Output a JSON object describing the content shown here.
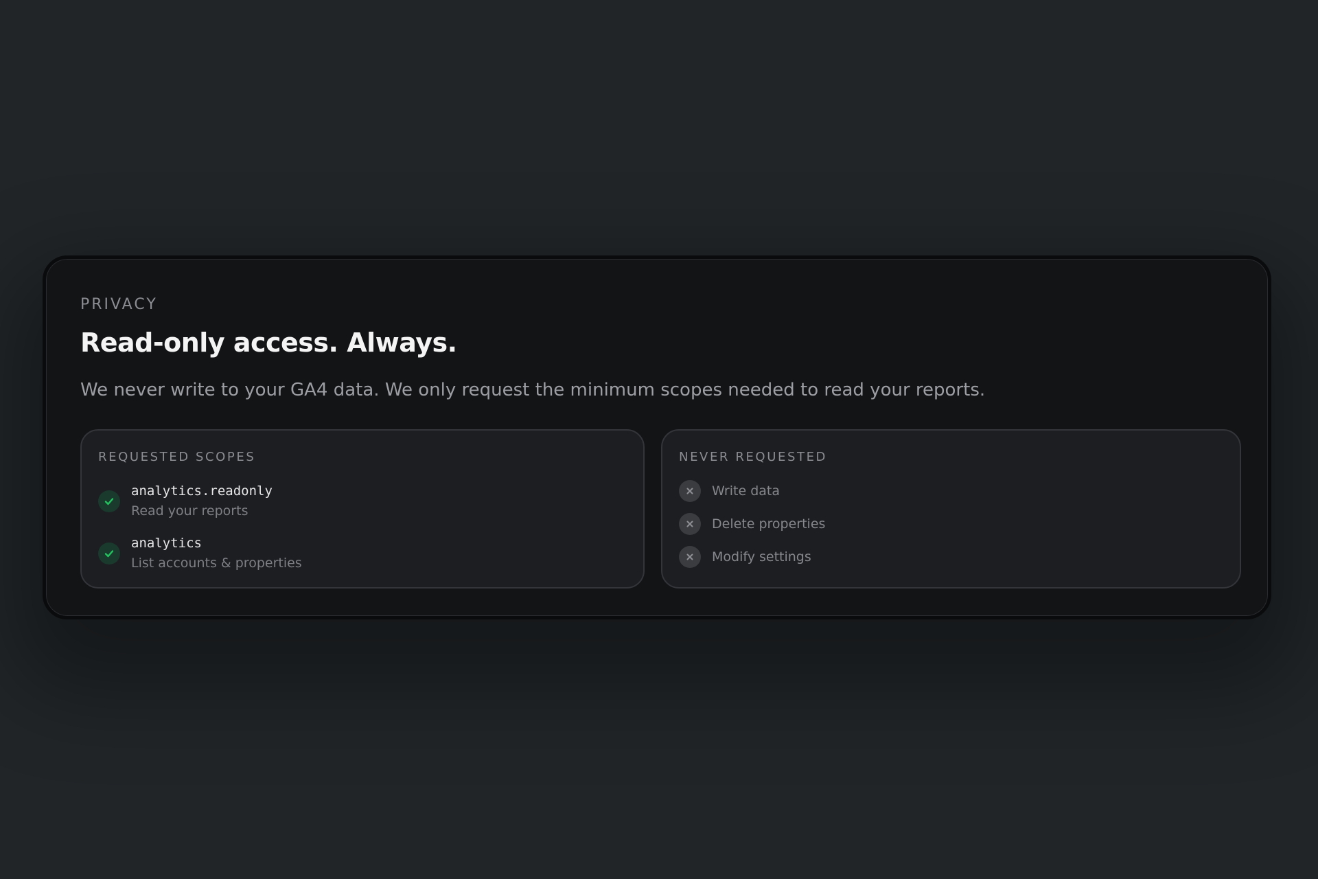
{
  "privacy": {
    "eyebrow": "PRIVACY",
    "title": "Read-only access. Always.",
    "description": "We never write to your GA4 data. We only request the minimum scopes needed to read your reports."
  },
  "requested": {
    "label": "REQUESTED SCOPES",
    "items": [
      {
        "scope": "analytics.readonly",
        "description": "Read your reports",
        "icon": "check-icon"
      },
      {
        "scope": "analytics",
        "description": "List accounts & properties",
        "icon": "check-icon"
      }
    ]
  },
  "never": {
    "label": "NEVER REQUESTED",
    "items": [
      {
        "label": "Write data",
        "icon": "x-icon"
      },
      {
        "label": "Delete properties",
        "icon": "x-icon"
      },
      {
        "label": "Modify settings",
        "icon": "x-icon"
      }
    ]
  },
  "colors": {
    "background": "#212528",
    "card": "#131416",
    "panel": "#1d1e21",
    "accent_green": "#22c55e",
    "muted_icon": "#3b3c40"
  }
}
